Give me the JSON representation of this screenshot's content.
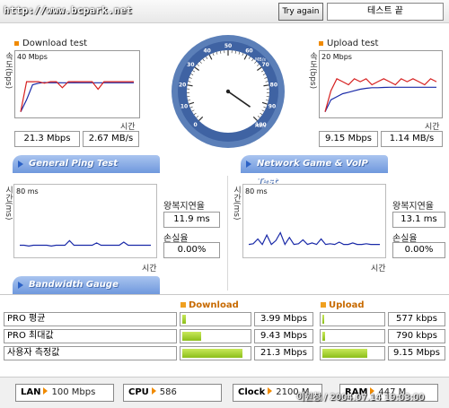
{
  "header": {
    "site_url": "http://www.bcpark.net",
    "try_again_label": "Try again",
    "status_text": "테스트 끝"
  },
  "download_test": {
    "title": "Download test",
    "axis_label": "속도(bps)",
    "scale_label": "40 Mbps",
    "time_label": "시간",
    "speed_mbps": "21.3 Mbps",
    "speed_mbs": "2.67 MB/s"
  },
  "upload_test": {
    "title": "Upload test",
    "axis_label": "속도(bps)",
    "scale_label": "20 Mbps",
    "time_label": "시간",
    "speed_mbps": "9.15 Mbps",
    "speed_mbs": "1.14 MB/s"
  },
  "speedometer": {
    "ticks": [
      "0",
      "10",
      "20",
      "30",
      "40",
      "50",
      "60",
      "70",
      "80",
      "90",
      "100"
    ],
    "unit_top": "MB/s",
    "unit_bottom": "MB/s"
  },
  "tabs": {
    "ping": "General Ping Test",
    "game": "Network Game & VoIP Test",
    "bandwidth": "Bandwidth Gauge"
  },
  "ping_test": {
    "axis_label": "시간(ms)",
    "scale_label": "80 ms",
    "time_label": "시간",
    "latency_label": "왕복지연율",
    "latency_value": "11.9 ms",
    "loss_label": "손실율",
    "loss_value": "0.00%"
  },
  "game_test": {
    "axis_label": "시간(ms)",
    "scale_label": "80 ms",
    "time_label": "시간",
    "latency_label": "왕복지연율",
    "latency_value": "13.1 ms",
    "loss_label": "손실율",
    "loss_value": "0.00%"
  },
  "bandwidth": {
    "download_header": "Download",
    "upload_header": "Upload",
    "rows": [
      {
        "label": "PRO 평균",
        "download": "3.99 Mbps",
        "download_level": 0.06,
        "upload": "577 kbps",
        "upload_level": 0.03
      },
      {
        "label": "PRO 최대값",
        "download": "9.43 Mbps",
        "download_level": 0.28,
        "upload": "790 kbps",
        "upload_level": 0.04
      },
      {
        "label": "사용자 측정값",
        "download": "21.3 Mbps",
        "download_level": 0.9,
        "upload": "9.15 Mbps",
        "upload_level": 0.75
      }
    ]
  },
  "footer": {
    "lan_key": "LAN",
    "lan_value": "100 Mbps",
    "cpu_key": "CPU",
    "cpu_value": "586",
    "clock_key": "Clock",
    "clock_value": "2100 M",
    "ram_key": "RAM",
    "ram_value": "447 M",
    "watermark": "이원창 / 2004.07.14 19:03:00"
  },
  "colors": {
    "accent_orange": "#f08a00",
    "tab_blue": "#6f98dd",
    "bar_green": "#8cbf1a",
    "graph_blue": "#1a2aa8",
    "graph_red": "#d62020"
  },
  "chart_data": [
    {
      "type": "line",
      "title": "Download test",
      "ylabel": "속도(bps)",
      "xlabel": "시간",
      "ylim": [
        0,
        40
      ],
      "series": [
        {
          "values": [
            2,
            10,
            20,
            21,
            21.5,
            21.3,
            21.4,
            21.3,
            21.3,
            21.4,
            21.3,
            21.3,
            21.3,
            21.3,
            21.3,
            21.3,
            21.3,
            21.3,
            21.3,
            21.3
          ]
        },
        {
          "values": [
            2,
            22,
            22,
            22,
            21,
            22,
            22,
            18,
            22,
            22,
            22,
            22,
            22,
            17,
            22,
            22,
            22,
            22,
            22,
            22
          ]
        }
      ]
    },
    {
      "type": "line",
      "title": "Upload test",
      "ylabel": "속도(bps)",
      "xlabel": "시간",
      "ylim": [
        0,
        20
      ],
      "series": [
        {
          "values": [
            1,
            5,
            6,
            7,
            7.5,
            8,
            8.5,
            8.8,
            9,
            9,
            9.1,
            9.15,
            9.15,
            9.15,
            9.15,
            9.15,
            9.15,
            9.15,
            9.15,
            9.15
          ]
        },
        {
          "values": [
            1,
            8,
            12,
            11,
            10,
            12,
            11,
            12,
            10,
            11,
            12,
            11,
            10,
            12,
            11,
            12,
            11,
            10,
            12,
            11
          ]
        }
      ]
    },
    {
      "type": "line",
      "ylabel": "시간(ms)",
      "xlabel": "시간",
      "ylim": [
        0,
        80
      ],
      "series": [
        {
          "values": [
            12,
            12,
            11,
            12,
            12,
            12,
            12,
            11,
            12,
            12,
            12,
            18,
            12,
            12,
            12,
            12,
            12,
            15,
            12,
            12,
            12,
            12,
            12,
            16,
            12,
            12,
            12,
            12,
            12,
            12
          ]
        }
      ]
    },
    {
      "type": "line",
      "ylabel": "시간(ms)",
      "xlabel": "시간",
      "ylim": [
        0,
        80
      ],
      "series": [
        {
          "values": [
            13,
            14,
            20,
            13,
            25,
            13,
            18,
            28,
            13,
            22,
            13,
            14,
            19,
            13,
            15,
            13,
            20,
            13,
            14,
            13,
            16,
            13,
            13,
            15,
            13,
            13,
            14,
            13,
            13,
            13
          ]
        }
      ]
    }
  ]
}
